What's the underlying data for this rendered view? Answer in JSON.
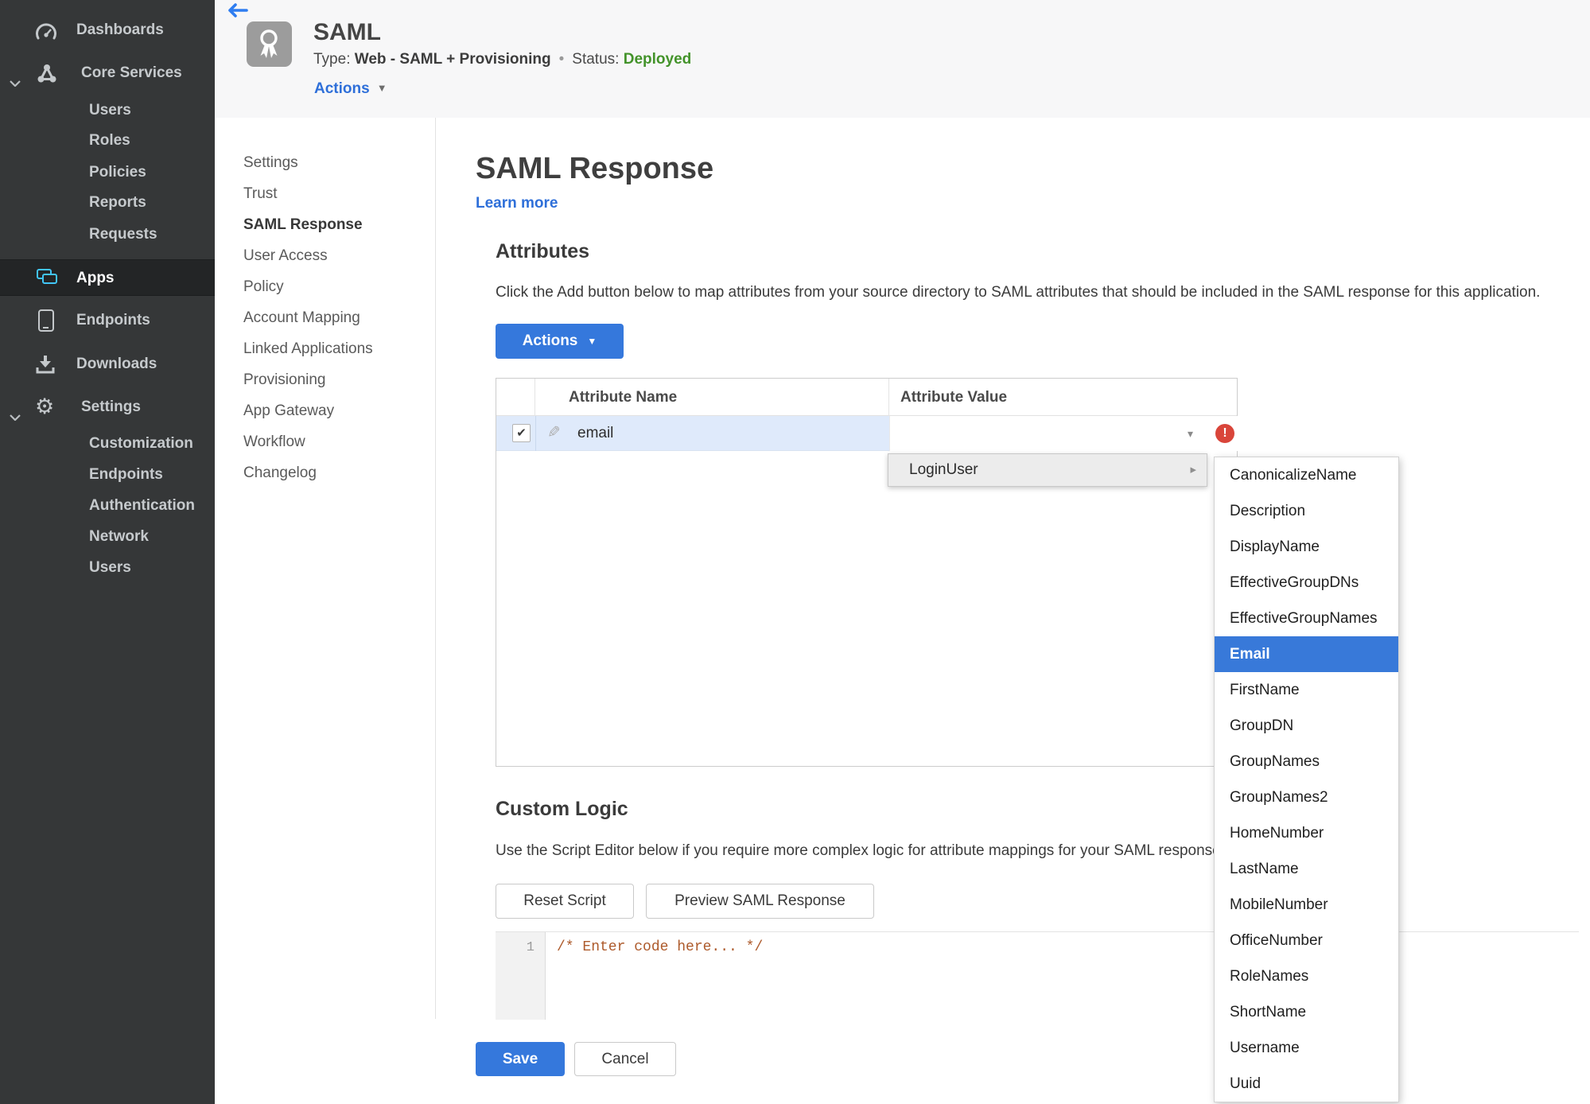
{
  "icons": {
    "check": "✔",
    "pencil": "✎",
    "caret_down": "▼",
    "caret_small": "▾",
    "submenu_arrow": "▸",
    "exclamation": "!",
    "bullet": "•",
    "gear": "⚙"
  },
  "sidebar": {
    "dashboards": "Dashboards",
    "core_services": "Core Services",
    "core_children": [
      "Users",
      "Roles",
      "Policies",
      "Reports",
      "Requests"
    ],
    "apps": "Apps",
    "endpoints": "Endpoints",
    "downloads": "Downloads",
    "settings": "Settings",
    "settings_children": [
      "Customization",
      "Endpoints",
      "Authentication",
      "Network",
      "Users"
    ]
  },
  "header": {
    "title": "SAML",
    "type_label": "Type:",
    "type_value": "Web - SAML + Provisioning",
    "status_label": "Status:",
    "status_value": "Deployed",
    "actions_label": "Actions"
  },
  "subnav": {
    "items": [
      "Settings",
      "Trust",
      "SAML Response",
      "User Access",
      "Policy",
      "Account Mapping",
      "Linked Applications",
      "Provisioning",
      "App Gateway",
      "Workflow",
      "Changelog"
    ],
    "active": "SAML Response"
  },
  "content": {
    "page_title": "SAML Response",
    "learn_more": "Learn more",
    "attributes_heading": "Attributes",
    "attributes_description": "Click the Add button below to map attributes from your source directory to SAML attributes that should be included in the SAML response for this application.",
    "actions_button": "Actions",
    "table": {
      "columns": [
        "Attribute Name",
        "Attribute Value"
      ],
      "row": {
        "name": "email",
        "value": "",
        "checked": true,
        "error": true
      }
    },
    "custom_logic_heading": "Custom Logic",
    "custom_logic_description": "Use the Script Editor below if you require more complex logic for attribute mappings for your SAML response.",
    "reset_button": "Reset Script",
    "preview_button": "Preview SAML Response",
    "editor": {
      "line_number": "1",
      "code": "/* Enter code here... */"
    },
    "save_button": "Save",
    "cancel_button": "Cancel"
  },
  "dropdown": {
    "parent_label": "LoginUser",
    "items": [
      "CanonicalizeName",
      "Description",
      "DisplayName",
      "EffectiveGroupDNs",
      "EffectiveGroupNames",
      "Email",
      "FirstName",
      "GroupDN",
      "GroupNames",
      "GroupNames2",
      "HomeNumber",
      "LastName",
      "MobileNumber",
      "OfficeNumber",
      "RoleNames",
      "ShortName",
      "Username",
      "Uuid"
    ],
    "selected": "Email"
  },
  "colors": {
    "accent_blue": "#3578dc",
    "link_blue": "#2e6fd9",
    "status_green": "#43932a",
    "selection_blue": "#3879d9",
    "error_red": "#d9453a",
    "row_highlight": "#dfeafb",
    "sidebar_bg": "#353738",
    "sidebar_active_bg": "#232526",
    "apps_icon_blue": "#41c5f5"
  }
}
